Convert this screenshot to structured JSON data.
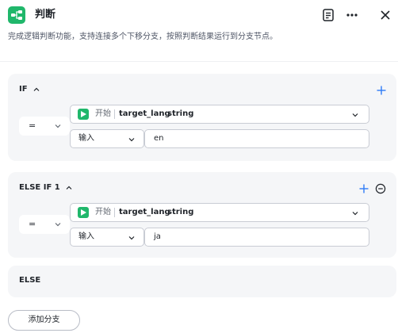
{
  "header": {
    "title": "判断",
    "description": "完成逻辑判断功能，支持连接多个下移分支，按照判断结果运行到分支节点。",
    "icons": {
      "logo": "branch-node-icon",
      "notes": "notes-icon",
      "more": "more-icon",
      "close": "close-icon"
    }
  },
  "branches": [
    {
      "label": "IF",
      "operator": "=",
      "variable": {
        "source": "开始",
        "name": "target_lang",
        "type": "string"
      },
      "input_mode": "输入",
      "value": "en"
    },
    {
      "label": "ELSE IF 1",
      "operator": "=",
      "variable": {
        "source": "开始",
        "name": "target_lang",
        "type": "string"
      },
      "input_mode": "输入",
      "value": "ja"
    }
  ],
  "else_label": "ELSE",
  "add_branch_label": "添加分支",
  "colors": {
    "accent": "#2f7cf6",
    "brand_green": "#20b76b",
    "panel_bg": "#f5f6f8",
    "border": "#c9ccd4"
  }
}
